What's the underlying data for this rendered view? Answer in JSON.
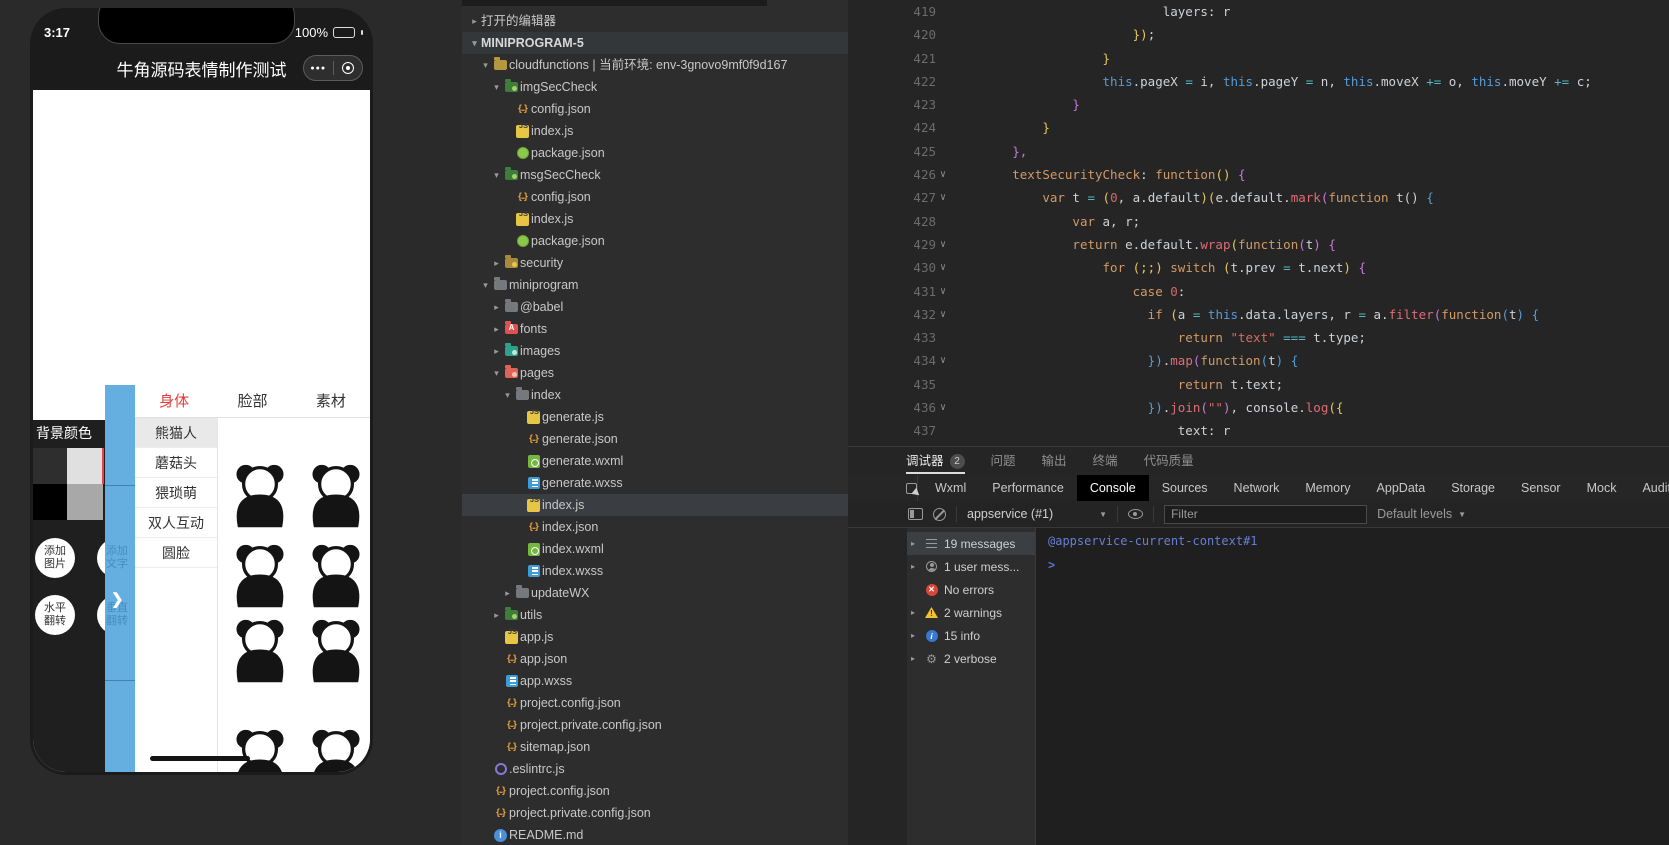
{
  "simulator": {
    "status_bar": {
      "time": "3:17",
      "battery_percent": "100%"
    },
    "nav": {
      "title": "牛角源码表情制作测试"
    },
    "sheet": {
      "tabs": [
        {
          "label": "身体",
          "active": true
        },
        {
          "label": "脸部",
          "active": false
        },
        {
          "label": "素材",
          "active": false
        }
      ],
      "categories": [
        {
          "label": "熊猫人",
          "selected": true
        },
        {
          "label": "蘑菇头",
          "selected": false
        },
        {
          "label": "猥琐萌",
          "selected": false
        },
        {
          "label": "双人互动",
          "selected": false
        },
        {
          "label": "圆脸",
          "selected": false
        }
      ],
      "stickers": [
        {
          "name": "panda-sticker-1"
        },
        {
          "name": "panda-sticker-2"
        },
        {
          "name": "panda-sticker-3"
        },
        {
          "name": "panda-sticker-4"
        },
        {
          "name": "panda-sticker-5"
        },
        {
          "name": "panda-sticker-6"
        },
        {
          "name": "panda-sticker-7"
        },
        {
          "name": "panda-sticker-8"
        }
      ]
    },
    "bg_color_panel": {
      "title": "背景颜色",
      "swatches": [
        "#2e2e2e",
        "#e0e0e0",
        "#000000",
        "#a8a8a8"
      ],
      "selected_indicator_color": "#e8414d"
    },
    "buttons": [
      {
        "label_line1": "添加",
        "label_line2": "图片",
        "faded": false
      },
      {
        "label_line1": "添加",
        "label_line2": "文字",
        "faded": true
      },
      {
        "label_line1": "水平",
        "label_line2": "翻转",
        "faded": false
      },
      {
        "label_line1": "垂直",
        "label_line2": "翻转",
        "faded": true
      }
    ],
    "expander_chevron": "❯"
  },
  "explorer": {
    "items": [
      {
        "label": "打开的编辑器",
        "level": 0,
        "arrow": "closed",
        "icon": null
      },
      {
        "label": "MINIPROGRAM-5",
        "level": 0,
        "arrow": "open",
        "icon": null,
        "bold": true,
        "hl": true
      },
      {
        "label": "cloudfunctions | 当前环境: env-3gnovo9mf0f9d167",
        "level": 1,
        "arrow": "open",
        "icon": "folder-cloud"
      },
      {
        "label": "imgSecCheck",
        "level": 2,
        "arrow": "open",
        "icon": "folder-green"
      },
      {
        "label": "config.json",
        "level": 3,
        "icon": "json"
      },
      {
        "label": "index.js",
        "level": 3,
        "icon": "js"
      },
      {
        "label": "package.json",
        "level": 3,
        "icon": "node"
      },
      {
        "label": "msgSecCheck",
        "level": 2,
        "arrow": "open",
        "icon": "folder-green"
      },
      {
        "label": "config.json",
        "level": 3,
        "icon": "json"
      },
      {
        "label": "index.js",
        "level": 3,
        "icon": "js"
      },
      {
        "label": "package.json",
        "level": 3,
        "icon": "node"
      },
      {
        "label": "security",
        "level": 2,
        "arrow": "closed",
        "icon": "folder-lock"
      },
      {
        "label": "miniprogram",
        "level": 1,
        "arrow": "open",
        "icon": "folder-gray"
      },
      {
        "label": "@babel",
        "level": 2,
        "arrow": "closed",
        "icon": "folder-gray"
      },
      {
        "label": "fonts",
        "level": 2,
        "arrow": "closed",
        "icon": "folder-font"
      },
      {
        "label": "images",
        "level": 2,
        "arrow": "closed",
        "icon": "folder-images"
      },
      {
        "label": "pages",
        "level": 2,
        "arrow": "open",
        "icon": "folder-pages"
      },
      {
        "label": "index",
        "level": 3,
        "arrow": "open",
        "icon": "folder-gray"
      },
      {
        "label": "generate.js",
        "level": 4,
        "icon": "js"
      },
      {
        "label": "generate.json",
        "level": 4,
        "icon": "json"
      },
      {
        "label": "generate.wxml",
        "level": 4,
        "icon": "wxml"
      },
      {
        "label": "generate.wxss",
        "level": 4,
        "icon": "wxss"
      },
      {
        "label": "index.js",
        "level": 4,
        "icon": "js",
        "selected": true
      },
      {
        "label": "index.json",
        "level": 4,
        "icon": "json"
      },
      {
        "label": "index.wxml",
        "level": 4,
        "icon": "wxml"
      },
      {
        "label": "index.wxss",
        "level": 4,
        "icon": "wxss"
      },
      {
        "label": "updateWX",
        "level": 3,
        "arrow": "closed",
        "icon": "folder-gray"
      },
      {
        "label": "utils",
        "level": 2,
        "arrow": "closed",
        "icon": "folder-green"
      },
      {
        "label": "app.js",
        "level": 2,
        "icon": "js"
      },
      {
        "label": "app.json",
        "level": 2,
        "icon": "json"
      },
      {
        "label": "app.wxss",
        "level": 2,
        "icon": "wxss"
      },
      {
        "label": "project.config.json",
        "level": 2,
        "icon": "json"
      },
      {
        "label": "project.private.config.json",
        "level": 2,
        "icon": "json"
      },
      {
        "label": "sitemap.json",
        "level": 2,
        "icon": "json"
      },
      {
        "label": ".eslintrc.js",
        "level": 1,
        "icon": "eslint"
      },
      {
        "label": "project.config.json",
        "level": 1,
        "icon": "json"
      },
      {
        "label": "project.private.config.json",
        "level": 1,
        "icon": "json"
      },
      {
        "label": "README.md",
        "level": 1,
        "icon": "readme"
      }
    ]
  },
  "editor": {
    "lines": [
      {
        "n": 419,
        "fold": false,
        "indent": 28,
        "tokens": [
          [
            "v",
            "layers: r"
          ]
        ]
      },
      {
        "n": 420,
        "fold": false,
        "indent": 24,
        "tokens": [
          [
            "p1",
            "})"
          ],
          [
            "v",
            ";"
          ]
        ]
      },
      {
        "n": 421,
        "fold": false,
        "indent": 20,
        "tokens": [
          [
            "p1",
            "}"
          ]
        ]
      },
      {
        "n": 422,
        "fold": false,
        "indent": 20,
        "tokens": [
          [
            "t",
            "this"
          ],
          [
            "v",
            ".pageX "
          ],
          [
            "o",
            "="
          ],
          [
            "v",
            " i, "
          ],
          [
            "t",
            "this"
          ],
          [
            "v",
            ".pageY "
          ],
          [
            "o",
            "="
          ],
          [
            "v",
            " n, "
          ],
          [
            "t",
            "this"
          ],
          [
            "v",
            ".moveX "
          ],
          [
            "o",
            "+="
          ],
          [
            "v",
            " o, "
          ],
          [
            "t",
            "this"
          ],
          [
            "v",
            ".moveY "
          ],
          [
            "o",
            "+="
          ],
          [
            "v",
            " c;"
          ]
        ]
      },
      {
        "n": 423,
        "fold": false,
        "indent": 16,
        "tokens": [
          [
            "p2",
            "}"
          ]
        ]
      },
      {
        "n": 424,
        "fold": false,
        "indent": 12,
        "tokens": [
          [
            "p1",
            "}"
          ]
        ]
      },
      {
        "n": 425,
        "fold": false,
        "indent": 8,
        "tokens": [
          [
            "p2",
            "},"
          ]
        ]
      },
      {
        "n": 426,
        "fold": true,
        "indent": 8,
        "tokens": [
          [
            "k",
            "textSecurityCheck"
          ],
          [
            "v",
            ": "
          ],
          [
            "k",
            "function"
          ],
          [
            "p1",
            "()"
          ],
          [
            "v",
            " "
          ],
          [
            "p2",
            "{"
          ]
        ]
      },
      {
        "n": 427,
        "fold": true,
        "indent": 12,
        "tokens": [
          [
            "k",
            "var"
          ],
          [
            "v",
            " t "
          ],
          [
            "o",
            "="
          ],
          [
            "v",
            " "
          ],
          [
            "p1",
            "("
          ],
          [
            "n",
            "0"
          ],
          [
            "v",
            ", a.default"
          ],
          [
            "p1",
            ")("
          ],
          [
            "v",
            "e.default."
          ],
          [
            "f",
            "mark"
          ],
          [
            "p2",
            "("
          ],
          [
            "k",
            "function"
          ],
          [
            "v",
            " t() "
          ],
          [
            "p3",
            "{"
          ]
        ]
      },
      {
        "n": 428,
        "fold": false,
        "indent": 16,
        "tokens": [
          [
            "k",
            "var"
          ],
          [
            "v",
            " a, r;"
          ]
        ]
      },
      {
        "n": 429,
        "fold": true,
        "indent": 16,
        "tokens": [
          [
            "k",
            "return"
          ],
          [
            "v",
            " e.default."
          ],
          [
            "f",
            "wrap"
          ],
          [
            "p1",
            "("
          ],
          [
            "k",
            "function"
          ],
          [
            "p2",
            "("
          ],
          [
            "v",
            "t"
          ],
          [
            "p2",
            ")"
          ],
          [
            "v",
            " "
          ],
          [
            "p2",
            "{"
          ]
        ]
      },
      {
        "n": 430,
        "fold": true,
        "indent": 20,
        "tokens": [
          [
            "k",
            "for"
          ],
          [
            "v",
            " "
          ],
          [
            "p1",
            "(;;)"
          ],
          [
            "v",
            " "
          ],
          [
            "k",
            "switch"
          ],
          [
            "v",
            " "
          ],
          [
            "p1",
            "("
          ],
          [
            "v",
            "t.prev "
          ],
          [
            "o",
            "="
          ],
          [
            "v",
            " t.next"
          ],
          [
            "p1",
            ")"
          ],
          [
            "v",
            " "
          ],
          [
            "p2",
            "{"
          ]
        ]
      },
      {
        "n": 431,
        "fold": true,
        "indent": 24,
        "tokens": [
          [
            "k",
            "case"
          ],
          [
            "v",
            " "
          ],
          [
            "n",
            "0"
          ],
          [
            "v",
            ":"
          ]
        ]
      },
      {
        "n": 432,
        "fold": true,
        "indent": 26,
        "tokens": [
          [
            "k",
            "if"
          ],
          [
            "v",
            " "
          ],
          [
            "p1",
            "("
          ],
          [
            "v",
            "a "
          ],
          [
            "o",
            "="
          ],
          [
            "v",
            " "
          ],
          [
            "t",
            "this"
          ],
          [
            "v",
            ".data.layers, r "
          ],
          [
            "o",
            "="
          ],
          [
            "v",
            " a."
          ],
          [
            "f",
            "filter"
          ],
          [
            "p2",
            "("
          ],
          [
            "k",
            "function"
          ],
          [
            "p3",
            "("
          ],
          [
            "v",
            "t"
          ],
          [
            "p3",
            ")"
          ],
          [
            "v",
            " "
          ],
          [
            "p3",
            "{"
          ]
        ]
      },
      {
        "n": 433,
        "fold": false,
        "indent": 30,
        "tokens": [
          [
            "k",
            "return"
          ],
          [
            "v",
            " "
          ],
          [
            "s",
            "\"text\""
          ],
          [
            "v",
            " "
          ],
          [
            "o",
            "==="
          ],
          [
            "v",
            " t.type;"
          ]
        ]
      },
      {
        "n": 434,
        "fold": true,
        "indent": 26,
        "tokens": [
          [
            "p3",
            "})"
          ],
          [
            "v",
            "."
          ],
          [
            "f",
            "map"
          ],
          [
            "p2",
            "("
          ],
          [
            "k",
            "function"
          ],
          [
            "p3",
            "("
          ],
          [
            "v",
            "t"
          ],
          [
            "p3",
            ")"
          ],
          [
            "v",
            " "
          ],
          [
            "p3",
            "{"
          ]
        ]
      },
      {
        "n": 435,
        "fold": false,
        "indent": 30,
        "tokens": [
          [
            "k",
            "return"
          ],
          [
            "v",
            " t.text;"
          ]
        ]
      },
      {
        "n": 436,
        "fold": true,
        "indent": 26,
        "tokens": [
          [
            "p3",
            "})"
          ],
          [
            "v",
            "."
          ],
          [
            "f",
            "join"
          ],
          [
            "p2",
            "("
          ],
          [
            "s",
            "\"\""
          ],
          [
            "p2",
            ")"
          ],
          [
            "v",
            ", console."
          ],
          [
            "f",
            "log"
          ],
          [
            "p1",
            "({"
          ]
        ]
      },
      {
        "n": 437,
        "fold": false,
        "indent": 30,
        "tokens": [
          [
            "v",
            "text: r"
          ]
        ]
      }
    ]
  },
  "debugger": {
    "panel_tabs": [
      {
        "label": "调试器",
        "badge": "2",
        "active": true
      },
      {
        "label": "问题",
        "active": false
      },
      {
        "label": "输出",
        "active": false
      },
      {
        "label": "终端",
        "active": false
      },
      {
        "label": "代码质量",
        "active": false
      }
    ],
    "devtools_tabs": [
      {
        "label": "Wxml",
        "active": false
      },
      {
        "label": "Performance",
        "active": false
      },
      {
        "label": "Console",
        "active": true
      },
      {
        "label": "Sources",
        "active": false
      },
      {
        "label": "Network",
        "active": false
      },
      {
        "label": "Memory",
        "active": false
      },
      {
        "label": "AppData",
        "active": false
      },
      {
        "label": "Storage",
        "active": false
      },
      {
        "label": "Sensor",
        "active": false
      },
      {
        "label": "Mock",
        "active": false
      },
      {
        "label": "Audits",
        "active": false
      }
    ],
    "toolbar": {
      "context": "appservice (#1)",
      "filter_placeholder": "Filter",
      "levels_label": "Default levels"
    },
    "console": {
      "sidebar": [
        {
          "icon": "list-icon",
          "label": "19 messages",
          "selected": true,
          "arrow": true
        },
        {
          "icon": "user-icon",
          "label": "1 user mess...",
          "selected": false,
          "arrow": true
        },
        {
          "icon": "error-icon",
          "label": "No errors",
          "selected": false,
          "arrow": false
        },
        {
          "icon": "warning-icon",
          "label": "2 warnings",
          "selected": false,
          "arrow": true
        },
        {
          "icon": "info-icon",
          "label": "15 info",
          "selected": false,
          "arrow": true
        },
        {
          "icon": "verbose-icon",
          "label": "2 verbose",
          "selected": false,
          "arrow": true
        }
      ],
      "context_line": "@appservice-current-context#1",
      "prompt": ">"
    }
  }
}
